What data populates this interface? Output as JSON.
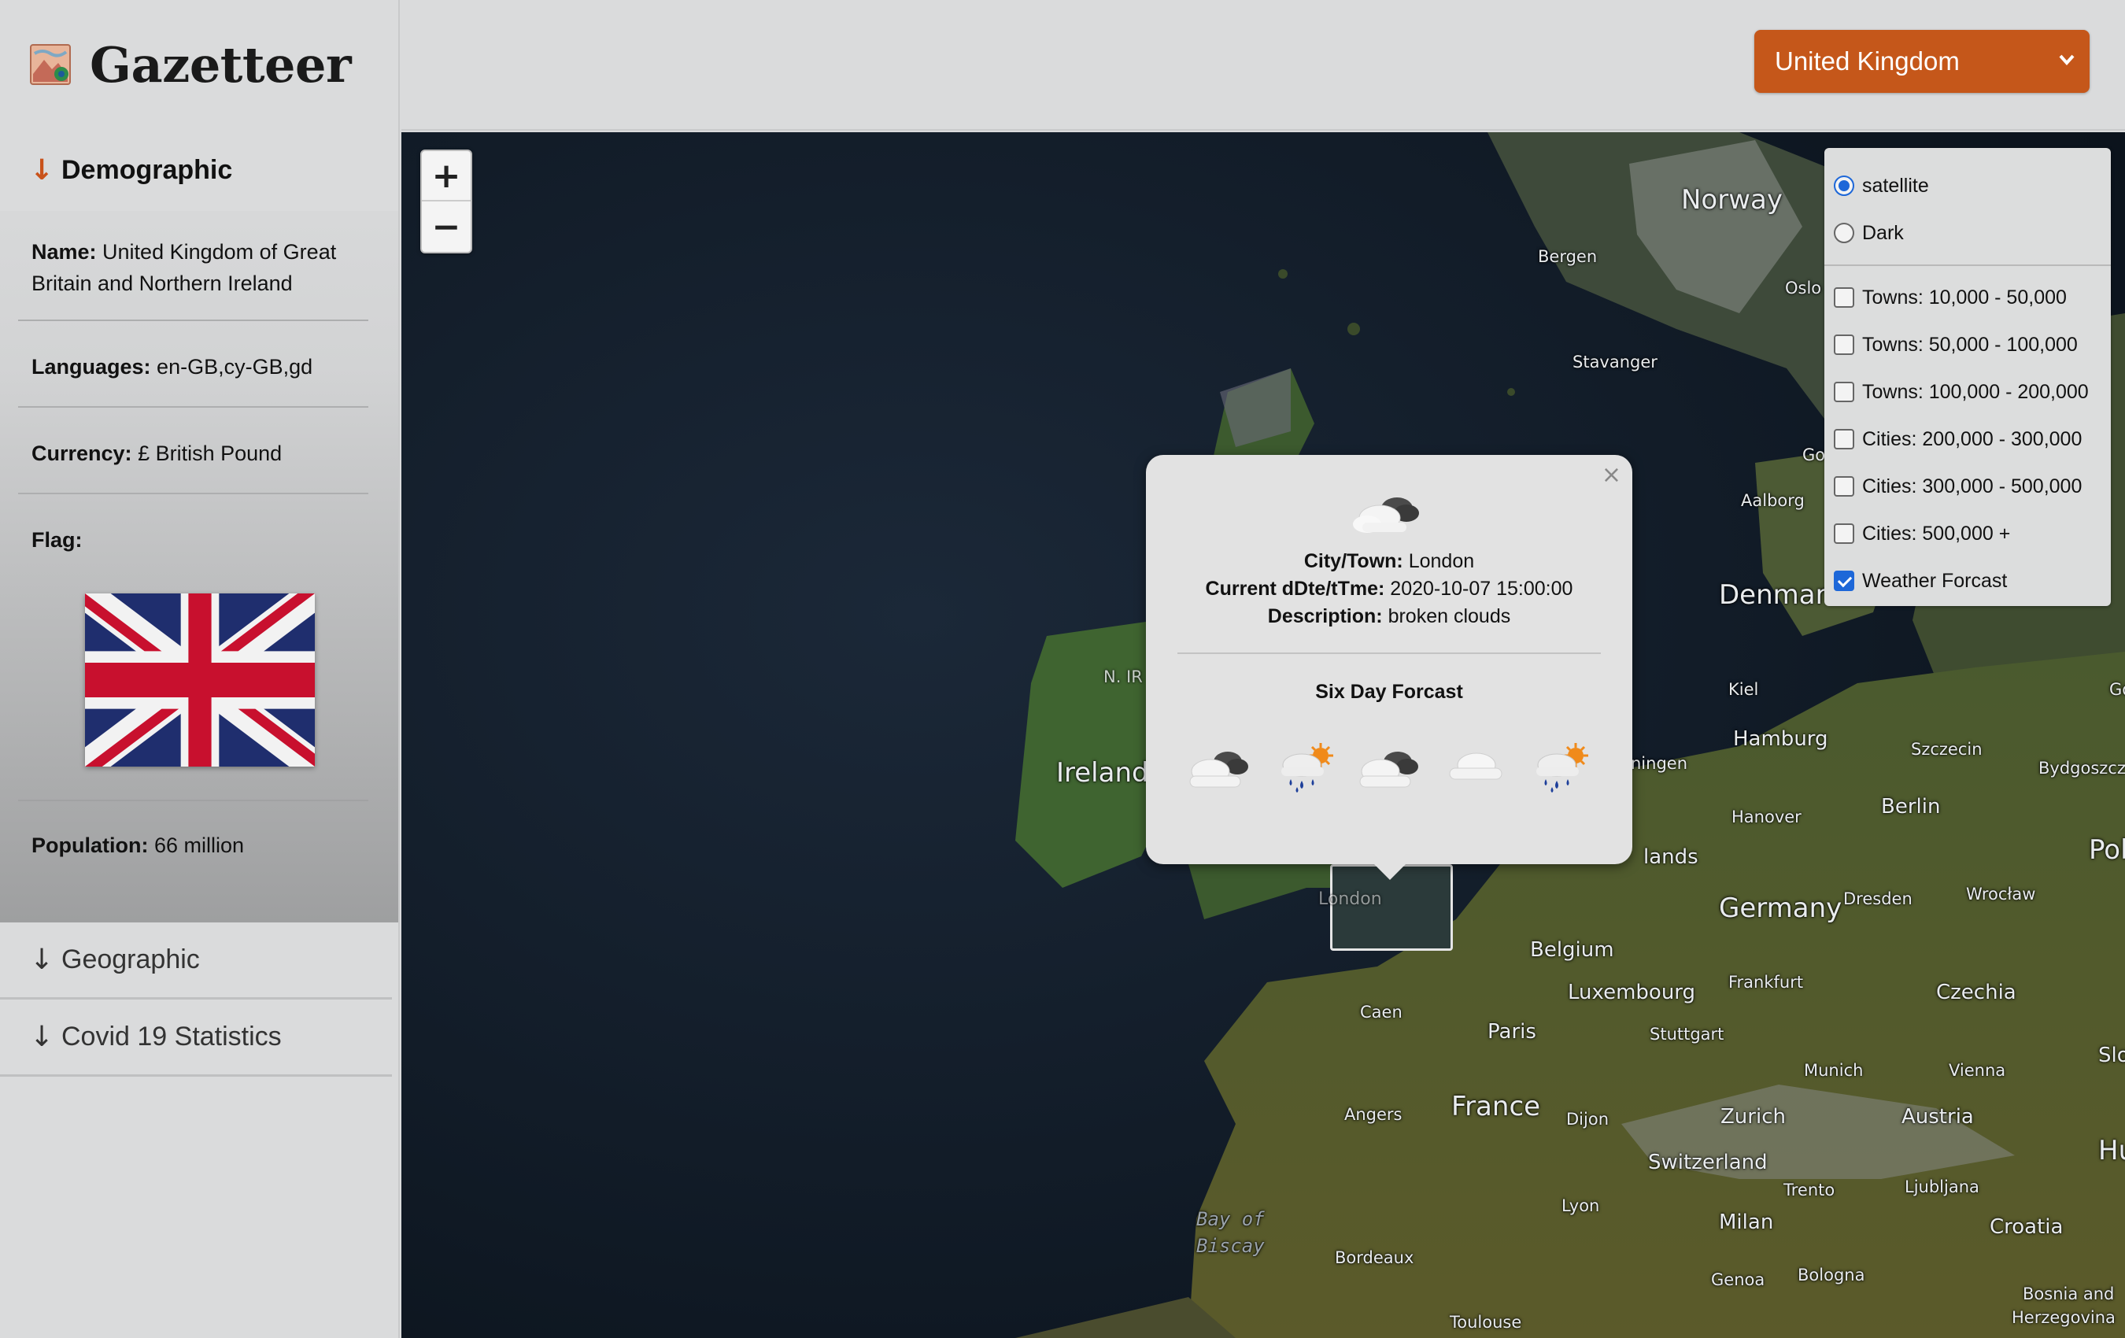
{
  "app": {
    "title": "Gazetteer",
    "logo_icon": "map-logo-icon"
  },
  "country_select": {
    "selected": "United Kingdom",
    "color": "#c5571a"
  },
  "sidebar": {
    "demographic": {
      "heading": "Demographic",
      "name_label": "Name:",
      "name_value": "United Kingdom of Great Britain and Northern Ireland",
      "languages_label": "Languages:",
      "languages_value": "en-GB,cy-GB,gd",
      "currency_label": "Currency:",
      "currency_value": "£ British Pound",
      "flag_label": "Flag:",
      "population_label": "Population:",
      "population_value": "66 million"
    },
    "geographic": {
      "heading": "Geographic"
    },
    "covid": {
      "heading": "Covid 19 Statistics"
    }
  },
  "map": {
    "zoom_in": "+",
    "zoom_out": "−",
    "labels": {
      "norway": "Norway",
      "bergen": "Bergen",
      "oslo": "Oslo",
      "stavanger": "Stavanger",
      "aalborg": "Aalborg",
      "go": "Go",
      "denmark": "Denmar",
      "kiel": "Kiel",
      "gdansk": "Gdans",
      "hamburg": "Hamburg",
      "szczecin": "Szczecin",
      "bydgoszcz": "Bydgoszcz",
      "hanover": "Hanover",
      "berlin": "Berlin",
      "pol": "Pol",
      "ireland": "Ireland",
      "nir": "N. IR",
      "ningen": "ningen",
      "lands": "lands",
      "germany": "Germany",
      "dresden": "Dresden",
      "wroclaw": "Wrocław",
      "belgium": "Belgium",
      "frankfurt": "Frankfurt",
      "luxembourg": "Luxembourg",
      "czechia": "Czechia",
      "caen": "Caen",
      "paris": "Paris",
      "stuttgart": "Stuttgart",
      "munich": "Munich",
      "vienna": "Vienna",
      "slo": "Slo",
      "angers": "Angers",
      "france": "France",
      "dijon": "Dijon",
      "zurich": "Zurich",
      "austria": "Austria",
      "hu": "Hu",
      "switzerland": "Switzerland",
      "trento": "Trento",
      "ljubljana": "Ljubljana",
      "lyon": "Lyon",
      "milan": "Milan",
      "croatia": "Croatia",
      "bay_of": "Bay of",
      "biscay": "Biscay",
      "bordeaux": "Bordeaux",
      "genoa": "Genoa",
      "bologna": "Bologna",
      "bosnia": "Bosnia and",
      "herzegovina": "Herzegovina",
      "toulouse": "Toulouse",
      "london": "London"
    }
  },
  "layers": {
    "base": [
      {
        "label": "satellite",
        "checked": true
      },
      {
        "label": "Dark",
        "checked": false
      }
    ],
    "overlays": [
      {
        "label": "Towns: 10,000 - 50,000",
        "checked": false
      },
      {
        "label": "Towns: 50,000 - 100,000",
        "checked": false
      },
      {
        "label": "Towns: 100,000 - 200,000",
        "checked": false
      },
      {
        "label": "Cities: 200,000 - 300,000",
        "checked": false
      },
      {
        "label": "Cities: 300,000 - 500,000",
        "checked": false
      },
      {
        "label": "Cities: 500,000 +",
        "checked": false
      },
      {
        "label": "Weather Forcast",
        "checked": true
      }
    ]
  },
  "popup": {
    "close": "×",
    "current_icon": "broken-clouds-icon",
    "city_label": "City/Town:",
    "city_value": "London",
    "datetime_label": "Current dDte/tTme:",
    "datetime_value": "2020-10-07 15:00:00",
    "description_label": "Description:",
    "description_value": "broken clouds",
    "forecast_title": "Six Day Forcast",
    "forecast_icons": [
      "broken-clouds-icon",
      "rain-sun-icon",
      "broken-clouds-icon",
      "cloud-icon",
      "rain-sun-icon"
    ]
  }
}
